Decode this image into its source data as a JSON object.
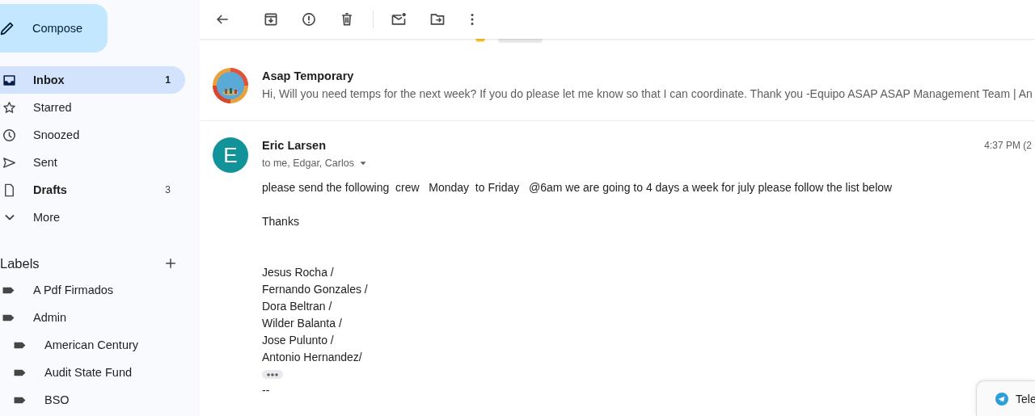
{
  "compose": {
    "label": "Compose"
  },
  "nav": [
    {
      "kind": "inbox",
      "label": "Inbox",
      "count": "1",
      "selected": true,
      "unread": true
    },
    {
      "kind": "star",
      "label": "Starred",
      "selected": false,
      "unread": false
    },
    {
      "kind": "clock",
      "label": "Snoozed",
      "selected": false,
      "unread": false
    },
    {
      "kind": "send",
      "label": "Sent",
      "selected": false,
      "unread": false
    },
    {
      "kind": "draft",
      "label": "Drafts",
      "count": "3",
      "selected": false,
      "unread": true
    },
    {
      "kind": "more",
      "label": "More",
      "selected": false,
      "unread": false
    }
  ],
  "labels": {
    "title": "Labels",
    "items": [
      {
        "name": "A Pdf Firmados"
      },
      {
        "name": "Admin",
        "children": [
          {
            "name": "American Century"
          },
          {
            "name": "Audit State Fund"
          },
          {
            "name": "BSO"
          }
        ]
      }
    ]
  },
  "messages": [
    {
      "kind": "collapsed",
      "sender": "Asap Temporary",
      "snippet": "Hi, Will you need temps for the next week? If you do please let me know so that I can coordinate. Thank you -Equipo ASAP ASAP Management Team | An"
    },
    {
      "kind": "expanded",
      "sender": "Eric Larsen",
      "avatar": {
        "kind": "letter",
        "letter": "E",
        "color": "#12939a"
      },
      "recipients": "to me, Edgar, Carlos",
      "time": "4:37 PM (2",
      "body": [
        "please send the following  crew   Monday  to Friday   @6am we are going to 4 days a week for july please follow the list below",
        "Thanks"
      ],
      "crew": [
        "Jesus Rocha /",
        "Fernando Gonzales /",
        "Dora Beltran /",
        "Wilder Balanta /",
        "Jose Pulunto /",
        "Antonio Hernandez/"
      ],
      "signature": "--"
    }
  ],
  "popup": {
    "label": "Tele"
  }
}
